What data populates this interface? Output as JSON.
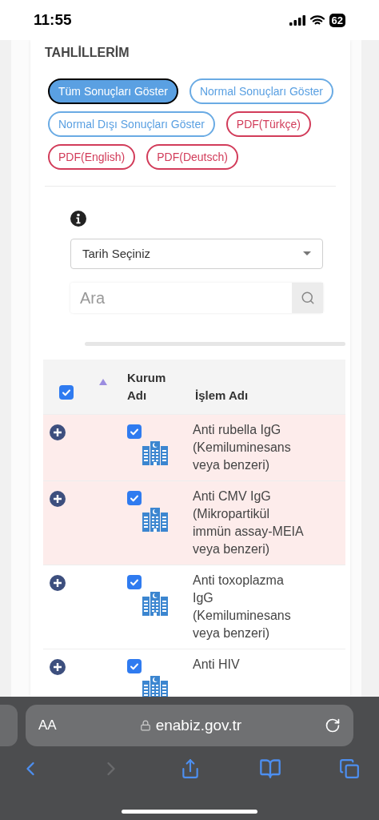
{
  "status_bar": {
    "time": "11:55",
    "battery": "62"
  },
  "section": {
    "title": "TAHLİLLERİM",
    "buttons": [
      {
        "label": "Tüm Sonuçları Göster",
        "kind": "filter",
        "selected": true
      },
      {
        "label": "Normal Sonuçları Göster",
        "kind": "filter",
        "selected": false
      },
      {
        "label": "Normal Dışı Sonuçları Göster",
        "kind": "filter",
        "selected": false
      },
      {
        "label": "PDF(Türkçe)",
        "kind": "pdf"
      },
      {
        "label": "PDF(English)",
        "kind": "pdf"
      },
      {
        "label": "PDF(Deutsch)",
        "kind": "pdf"
      }
    ]
  },
  "date_select": {
    "value": "Tarih Seçiniz"
  },
  "search": {
    "placeholder": "Ara"
  },
  "table": {
    "select_all_checked": true,
    "columns": [
      {
        "label": "Kurum Adı"
      },
      {
        "label": "İşlem Adı"
      }
    ],
    "rows": [
      {
        "checked": true,
        "abnormal": true,
        "test": "Anti rubella IgG (Kemiluminesans veya benzeri)"
      },
      {
        "checked": true,
        "abnormal": true,
        "test": "Anti CMV IgG (Mikropartikül immün assay-MEIA veya benzeri)"
      },
      {
        "checked": true,
        "abnormal": false,
        "test": "Anti toxoplazma IgG (Kemiluminesans veya benzeri)"
      },
      {
        "checked": true,
        "abnormal": false,
        "test": "Anti HIV"
      }
    ]
  },
  "browser": {
    "text_size": "AA",
    "url": "enabiz.gov.tr"
  }
}
